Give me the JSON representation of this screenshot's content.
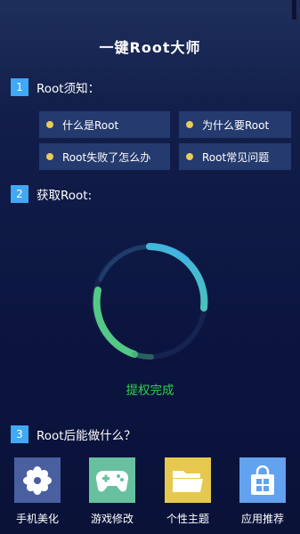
{
  "header": {
    "title": "一键Root大师"
  },
  "section1": {
    "number": "1",
    "title": "Root须知：",
    "items": [
      {
        "label": "什么是Root",
        "icon": "yellow-dot-icon"
      },
      {
        "label": "为什么要Root",
        "icon": "yellow-dot-icon"
      },
      {
        "label": "Root失败了怎么办",
        "icon": "yellow-dot-icon"
      },
      {
        "label": "Root常见问题",
        "icon": "yellow-dot-icon"
      }
    ]
  },
  "section2": {
    "number": "2",
    "title": "获取Root:",
    "status": "提权完成",
    "status_color": "#2bd14a",
    "ring_colors": {
      "start": "#57d38a",
      "end": "#3fb0ec"
    }
  },
  "section3": {
    "number": "3",
    "title": "Root后能做什么？",
    "features": [
      {
        "label": "手机美化",
        "icon": "flower-icon",
        "color": "#4a5fa0"
      },
      {
        "label": "游戏修改",
        "icon": "gamepad-icon",
        "color": "#67c19e"
      },
      {
        "label": "个性主题",
        "icon": "folder-icon",
        "color": "#e6c84e"
      },
      {
        "label": "应用推荐",
        "icon": "store-bag-icon",
        "color": "#62a2ee"
      }
    ]
  },
  "colors": {
    "badge": "#3fa9f5",
    "faq_bg": "#253a6e",
    "dot": "#e8cc57"
  }
}
